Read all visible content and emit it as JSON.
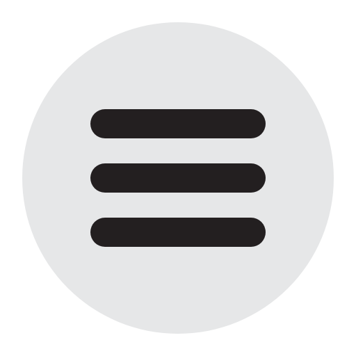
{
  "menu_button": {
    "icon": "hamburger-menu-icon",
    "background_color": "#e6e7e8",
    "bar_color": "#231f20",
    "bars": 3
  }
}
